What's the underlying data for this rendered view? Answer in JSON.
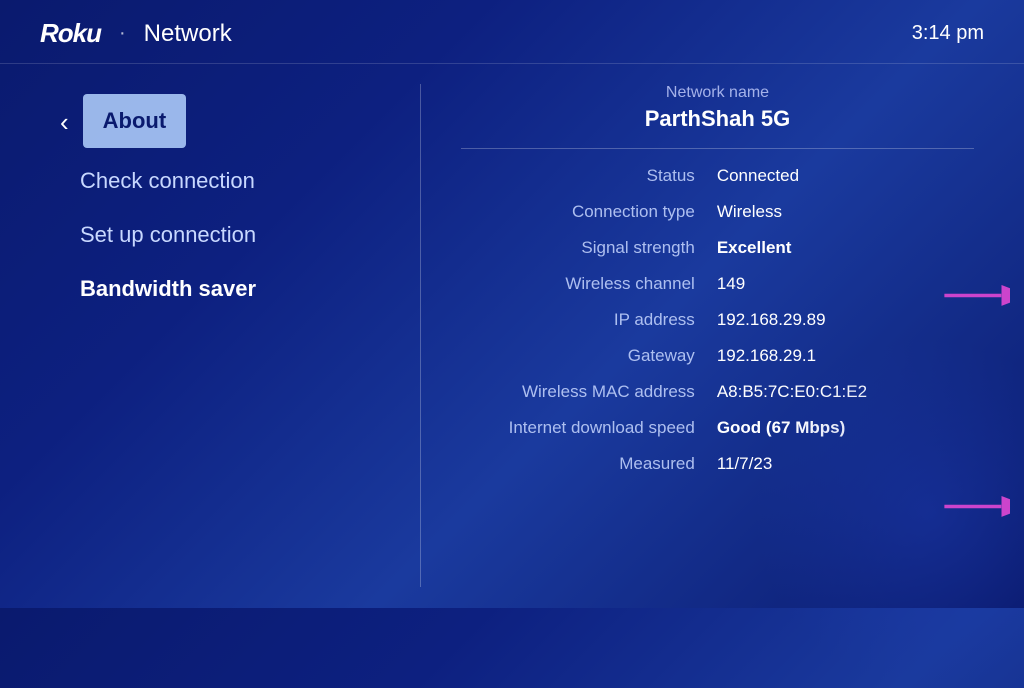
{
  "header": {
    "logo": "Roku",
    "dot": "·",
    "title": "Network",
    "time": "3:14 pm"
  },
  "sidebar": {
    "back_arrow": "‹",
    "menu_items": [
      {
        "id": "about",
        "label": "About",
        "active": true
      },
      {
        "id": "check-connection",
        "label": "Check connection",
        "active": false
      },
      {
        "id": "set-up-connection",
        "label": "Set up connection",
        "active": false
      },
      {
        "id": "bandwidth-saver",
        "label": "Bandwidth saver",
        "active": false
      }
    ]
  },
  "right_panel": {
    "network_name_label": "Network name",
    "network_name_value": "ParthShah 5G",
    "info_rows": [
      {
        "label": "Status",
        "value": "Connected",
        "bold": false
      },
      {
        "label": "Connection type",
        "value": "Wireless",
        "bold": false
      },
      {
        "label": "Signal strength",
        "value": "Excellent",
        "bold": true
      },
      {
        "label": "Wireless channel",
        "value": "149",
        "bold": false
      },
      {
        "label": "IP address",
        "value": "192.168.29.89",
        "bold": false
      },
      {
        "label": "Gateway",
        "value": "192.168.29.1",
        "bold": false
      },
      {
        "label": "Wireless MAC address",
        "value": "A8:B5:7C:E0:C1:E2",
        "bold": false
      },
      {
        "label": "Internet download speed",
        "value": "Good (67 Mbps)",
        "bold": true
      },
      {
        "label": "Measured",
        "value": "11/7/23",
        "bold": false
      }
    ]
  }
}
